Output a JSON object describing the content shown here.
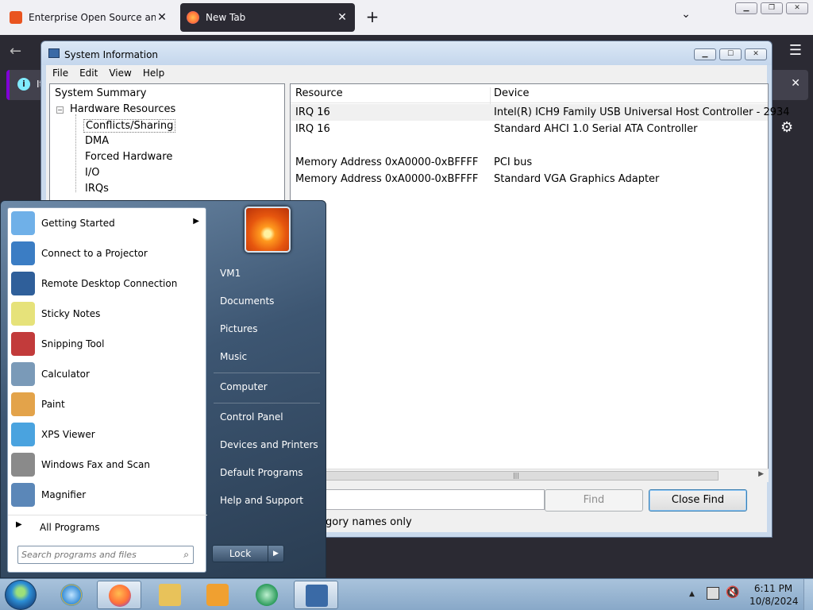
{
  "browser": {
    "tabs": [
      {
        "title": "Enterprise Open Source and Lin",
        "favicon_color": "#e95420"
      },
      {
        "title": "New Tab",
        "favicon_color": "#ff7139"
      }
    ],
    "infobar_text": "It"
  },
  "sysinfo": {
    "title": "System Information",
    "menu": [
      "File",
      "Edit",
      "View",
      "Help"
    ],
    "tree": {
      "root": "System Summary",
      "group": "Hardware Resources",
      "items": [
        "Conflicts/Sharing",
        "DMA",
        "Forced Hardware",
        "I/O",
        "IRQs"
      ]
    },
    "columns": [
      "Resource",
      "Device"
    ],
    "rows": [
      {
        "resource": "IRQ 16",
        "device": "Intel(R) ICH9 Family USB Universal Host Controller - 2934"
      },
      {
        "resource": "IRQ 16",
        "device": "Standard AHCI 1.0 Serial ATA Controller"
      },
      {
        "resource": "",
        "device": ""
      },
      {
        "resource": "Memory Address 0xA0000-0xBFFFF",
        "device": "PCI bus"
      },
      {
        "resource": "Memory Address 0xA0000-0xBFFFF",
        "device": "Standard VGA Graphics Adapter"
      }
    ],
    "find_button": "Find",
    "close_find_button": "Close Find",
    "category_names_fragment": "egory names only"
  },
  "startmenu": {
    "programs": [
      {
        "label": "Getting Started",
        "icon": "getting-started-icon",
        "color": "#6fb0e8",
        "submenu": true
      },
      {
        "label": "Connect to a Projector",
        "icon": "projector-icon",
        "color": "#3b7dc4",
        "submenu": false
      },
      {
        "label": "Remote Desktop Connection",
        "icon": "remote-desktop-icon",
        "color": "#2f5f9a",
        "submenu": false
      },
      {
        "label": "Sticky Notes",
        "icon": "sticky-notes-icon",
        "color": "#e6e27a",
        "submenu": false
      },
      {
        "label": "Snipping Tool",
        "icon": "scissors-icon",
        "color": "#c23b3b",
        "submenu": false
      },
      {
        "label": "Calculator",
        "icon": "calculator-icon",
        "color": "#7a9ab8",
        "submenu": false
      },
      {
        "label": "Paint",
        "icon": "paint-icon",
        "color": "#e3a34a",
        "submenu": false
      },
      {
        "label": "XPS Viewer",
        "icon": "xps-viewer-icon",
        "color": "#4aa3df",
        "submenu": false
      },
      {
        "label": "Windows Fax and Scan",
        "icon": "fax-icon",
        "color": "#8a8a8a",
        "submenu": false
      },
      {
        "label": "Magnifier",
        "icon": "magnifier-icon",
        "color": "#5b87b8",
        "submenu": false
      }
    ],
    "all_programs": "All Programs",
    "search_placeholder": "Search programs and files",
    "right_links": [
      "VM1",
      "Documents",
      "Pictures",
      "Music",
      "Computer",
      "Control Panel",
      "Devices and Printers",
      "Default Programs",
      "Help and Support"
    ],
    "lock_label": "Lock"
  },
  "taskbar": {
    "clock_time": "6:11 PM",
    "clock_date": "10/8/2024",
    "pinned": [
      {
        "name": "ie-icon",
        "color": "#3a8fd8"
      },
      {
        "name": "firefox-icon",
        "color": "#ff7139"
      },
      {
        "name": "explorer-icon",
        "color": "#e8c25a"
      },
      {
        "name": "media-player-icon",
        "color": "#f0a030"
      },
      {
        "name": "media-center-icon",
        "color": "#2a9a5a"
      },
      {
        "name": "sysinfo-icon",
        "color": "#3a6aa6"
      }
    ]
  }
}
